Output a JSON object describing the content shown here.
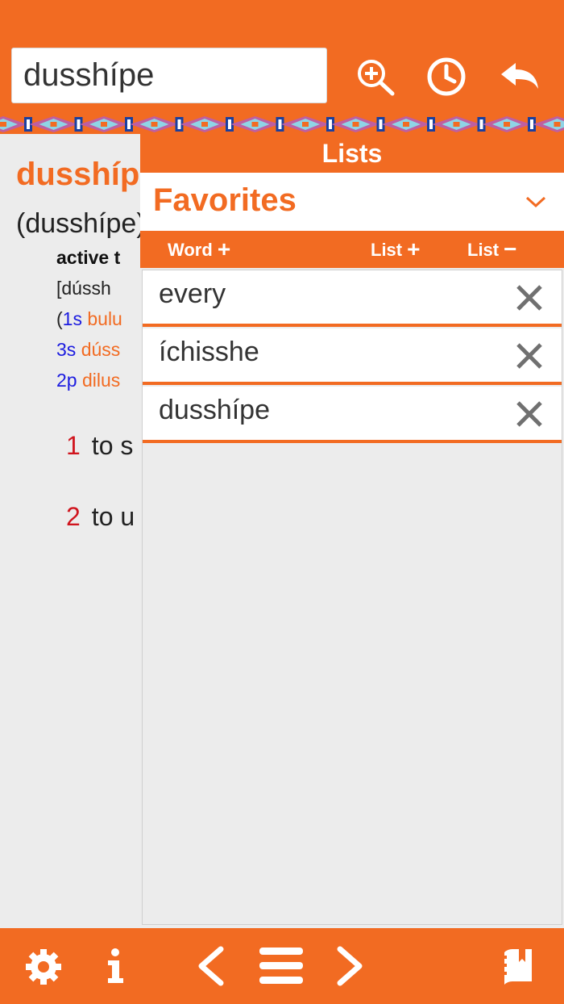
{
  "search": {
    "value": "dusshípe"
  },
  "entry": {
    "headword": "dusshípe",
    "parenthetical": "(dusshípe)",
    "pos": "active t",
    "pronunciation": "[dússh",
    "forms": [
      {
        "pre": "(",
        "person": "1s",
        "value": "bulu"
      },
      {
        "pre": "",
        "person": "3s",
        "value": "dúss"
      },
      {
        "pre": "",
        "person": "2p",
        "value": "dilus"
      }
    ],
    "senses": [
      {
        "num": "1",
        "text": "to s"
      },
      {
        "num": "2",
        "text": "to u"
      }
    ]
  },
  "lists_panel": {
    "title": "Lists",
    "selected_list": "Favorites",
    "actions": {
      "word_add": "Word",
      "list_add": "List",
      "list_remove": "List"
    },
    "words": [
      "every",
      "íchisshe",
      "dusshípe"
    ]
  },
  "colors": {
    "accent": "#f26b22",
    "person": "#1c1ce0",
    "sense_number": "#d0151e"
  },
  "icons": {
    "top": [
      "zoom-in-icon",
      "history-clock-icon",
      "back-arrow-icon"
    ],
    "bottom": [
      "gear-icon",
      "info-icon",
      "chevron-left-icon",
      "menu-icon",
      "chevron-right-icon",
      "bookmark-book-icon"
    ]
  }
}
